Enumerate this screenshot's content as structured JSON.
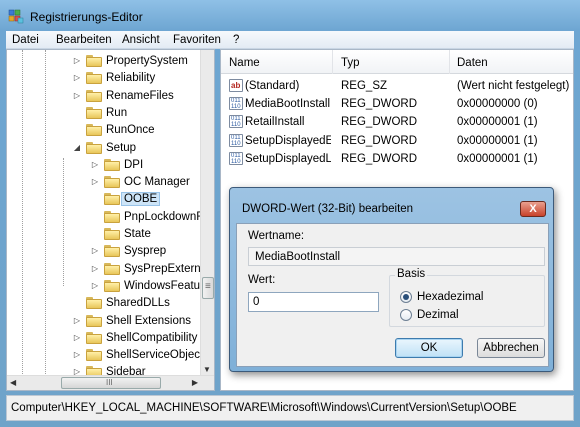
{
  "window": {
    "title": "Registrierungs-Editor"
  },
  "menu": [
    "Datei",
    "Bearbeiten",
    "Ansicht",
    "Favoriten",
    "?"
  ],
  "tree": {
    "items": [
      {
        "label": "PropertySystem",
        "level": 0,
        "expander": "right"
      },
      {
        "label": "Reliability",
        "level": 0,
        "expander": "right"
      },
      {
        "label": "RenameFiles",
        "level": 0,
        "expander": "right"
      },
      {
        "label": "Run",
        "level": 0,
        "expander": "none"
      },
      {
        "label": "RunOnce",
        "level": 0,
        "expander": "none"
      },
      {
        "label": "Setup",
        "level": 0,
        "expander": "down"
      },
      {
        "label": "DPI",
        "level": 1,
        "expander": "right"
      },
      {
        "label": "OC Manager",
        "level": 1,
        "expander": "right"
      },
      {
        "label": "OOBE",
        "level": 1,
        "expander": "none",
        "selected": true
      },
      {
        "label": "PnpLockdownF",
        "level": 1,
        "expander": "none"
      },
      {
        "label": "State",
        "level": 1,
        "expander": "none"
      },
      {
        "label": "Sysprep",
        "level": 1,
        "expander": "right"
      },
      {
        "label": "SysPrepExterna",
        "level": 1,
        "expander": "right"
      },
      {
        "label": "WindowsFeatu",
        "level": 1,
        "expander": "right"
      },
      {
        "label": "SharedDLLs",
        "level": 0,
        "expander": "none"
      },
      {
        "label": "Shell Extensions",
        "level": 0,
        "expander": "right"
      },
      {
        "label": "ShellCompatibility",
        "level": 0,
        "expander": "right"
      },
      {
        "label": "ShellServiceObject",
        "level": 0,
        "expander": "right"
      },
      {
        "label": "Sidebar",
        "level": 0,
        "expander": "right"
      }
    ],
    "hscroll_label": "III"
  },
  "list": {
    "columns": [
      "Name",
      "Typ",
      "Daten"
    ],
    "rows": [
      {
        "icon": "string-value-icon",
        "name": "(Standard)",
        "type": "REG_SZ",
        "data": "(Wert nicht festgelegt)"
      },
      {
        "icon": "dword-value-icon",
        "name": "MediaBootInstall",
        "type": "REG_DWORD",
        "data": "0x00000000 (0)"
      },
      {
        "icon": "dword-value-icon",
        "name": "RetailInstall",
        "type": "REG_DWORD",
        "data": "0x00000001 (1)"
      },
      {
        "icon": "dword-value-icon",
        "name": "SetupDisplayedE...",
        "type": "REG_DWORD",
        "data": "0x00000001 (1)"
      },
      {
        "icon": "dword-value-icon",
        "name": "SetupDisplayedL...",
        "type": "REG_DWORD",
        "data": "0x00000001 (1)"
      }
    ]
  },
  "statusbar": {
    "path": "Computer\\HKEY_LOCAL_MACHINE\\SOFTWARE\\Microsoft\\Windows\\CurrentVersion\\Setup\\OOBE"
  },
  "dialog": {
    "title": "DWORD-Wert (32-Bit) bearbeiten",
    "close_label": "X",
    "name_label": "Wertname:",
    "name_value": "MediaBootInstall",
    "value_label": "Wert:",
    "value": "0",
    "basis_label": "Basis",
    "radio_hex": "Hexadezimal",
    "radio_dec": "Dezimal",
    "selected_basis": "Hexadezimal",
    "ok_label": "OK",
    "cancel_label": "Abbrechen"
  },
  "colors": {
    "title_gradient": "#8fc0e6",
    "selection": "#cde4f7",
    "close_button": "#c8422a"
  }
}
